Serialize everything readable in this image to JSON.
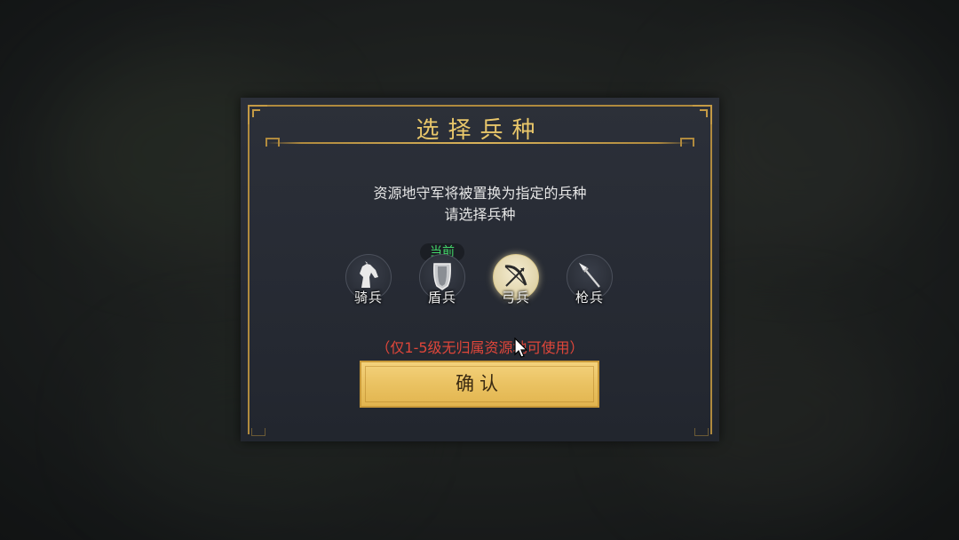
{
  "dialog": {
    "title": "选择兵种",
    "description_line1": "资源地守军将被置换为指定的兵种",
    "description_line2": "请选择兵种",
    "current_badge": "当前",
    "notice": "（仅1-5级无归属资源地可使用）",
    "confirm_label": "确认"
  },
  "troops": [
    {
      "label": "骑兵",
      "icon": "horse-icon",
      "selected": false,
      "current": false
    },
    {
      "label": "盾兵",
      "icon": "shield-icon",
      "selected": false,
      "current": true
    },
    {
      "label": "弓兵",
      "icon": "bow-icon",
      "selected": true,
      "current": false
    },
    {
      "label": "枪兵",
      "icon": "spear-icon",
      "selected": false,
      "current": false
    }
  ],
  "colors": {
    "title_gold": "#e8c66a",
    "current_green": "#43d86a",
    "notice_red": "#e0463a",
    "button_gold": "#eac262"
  }
}
